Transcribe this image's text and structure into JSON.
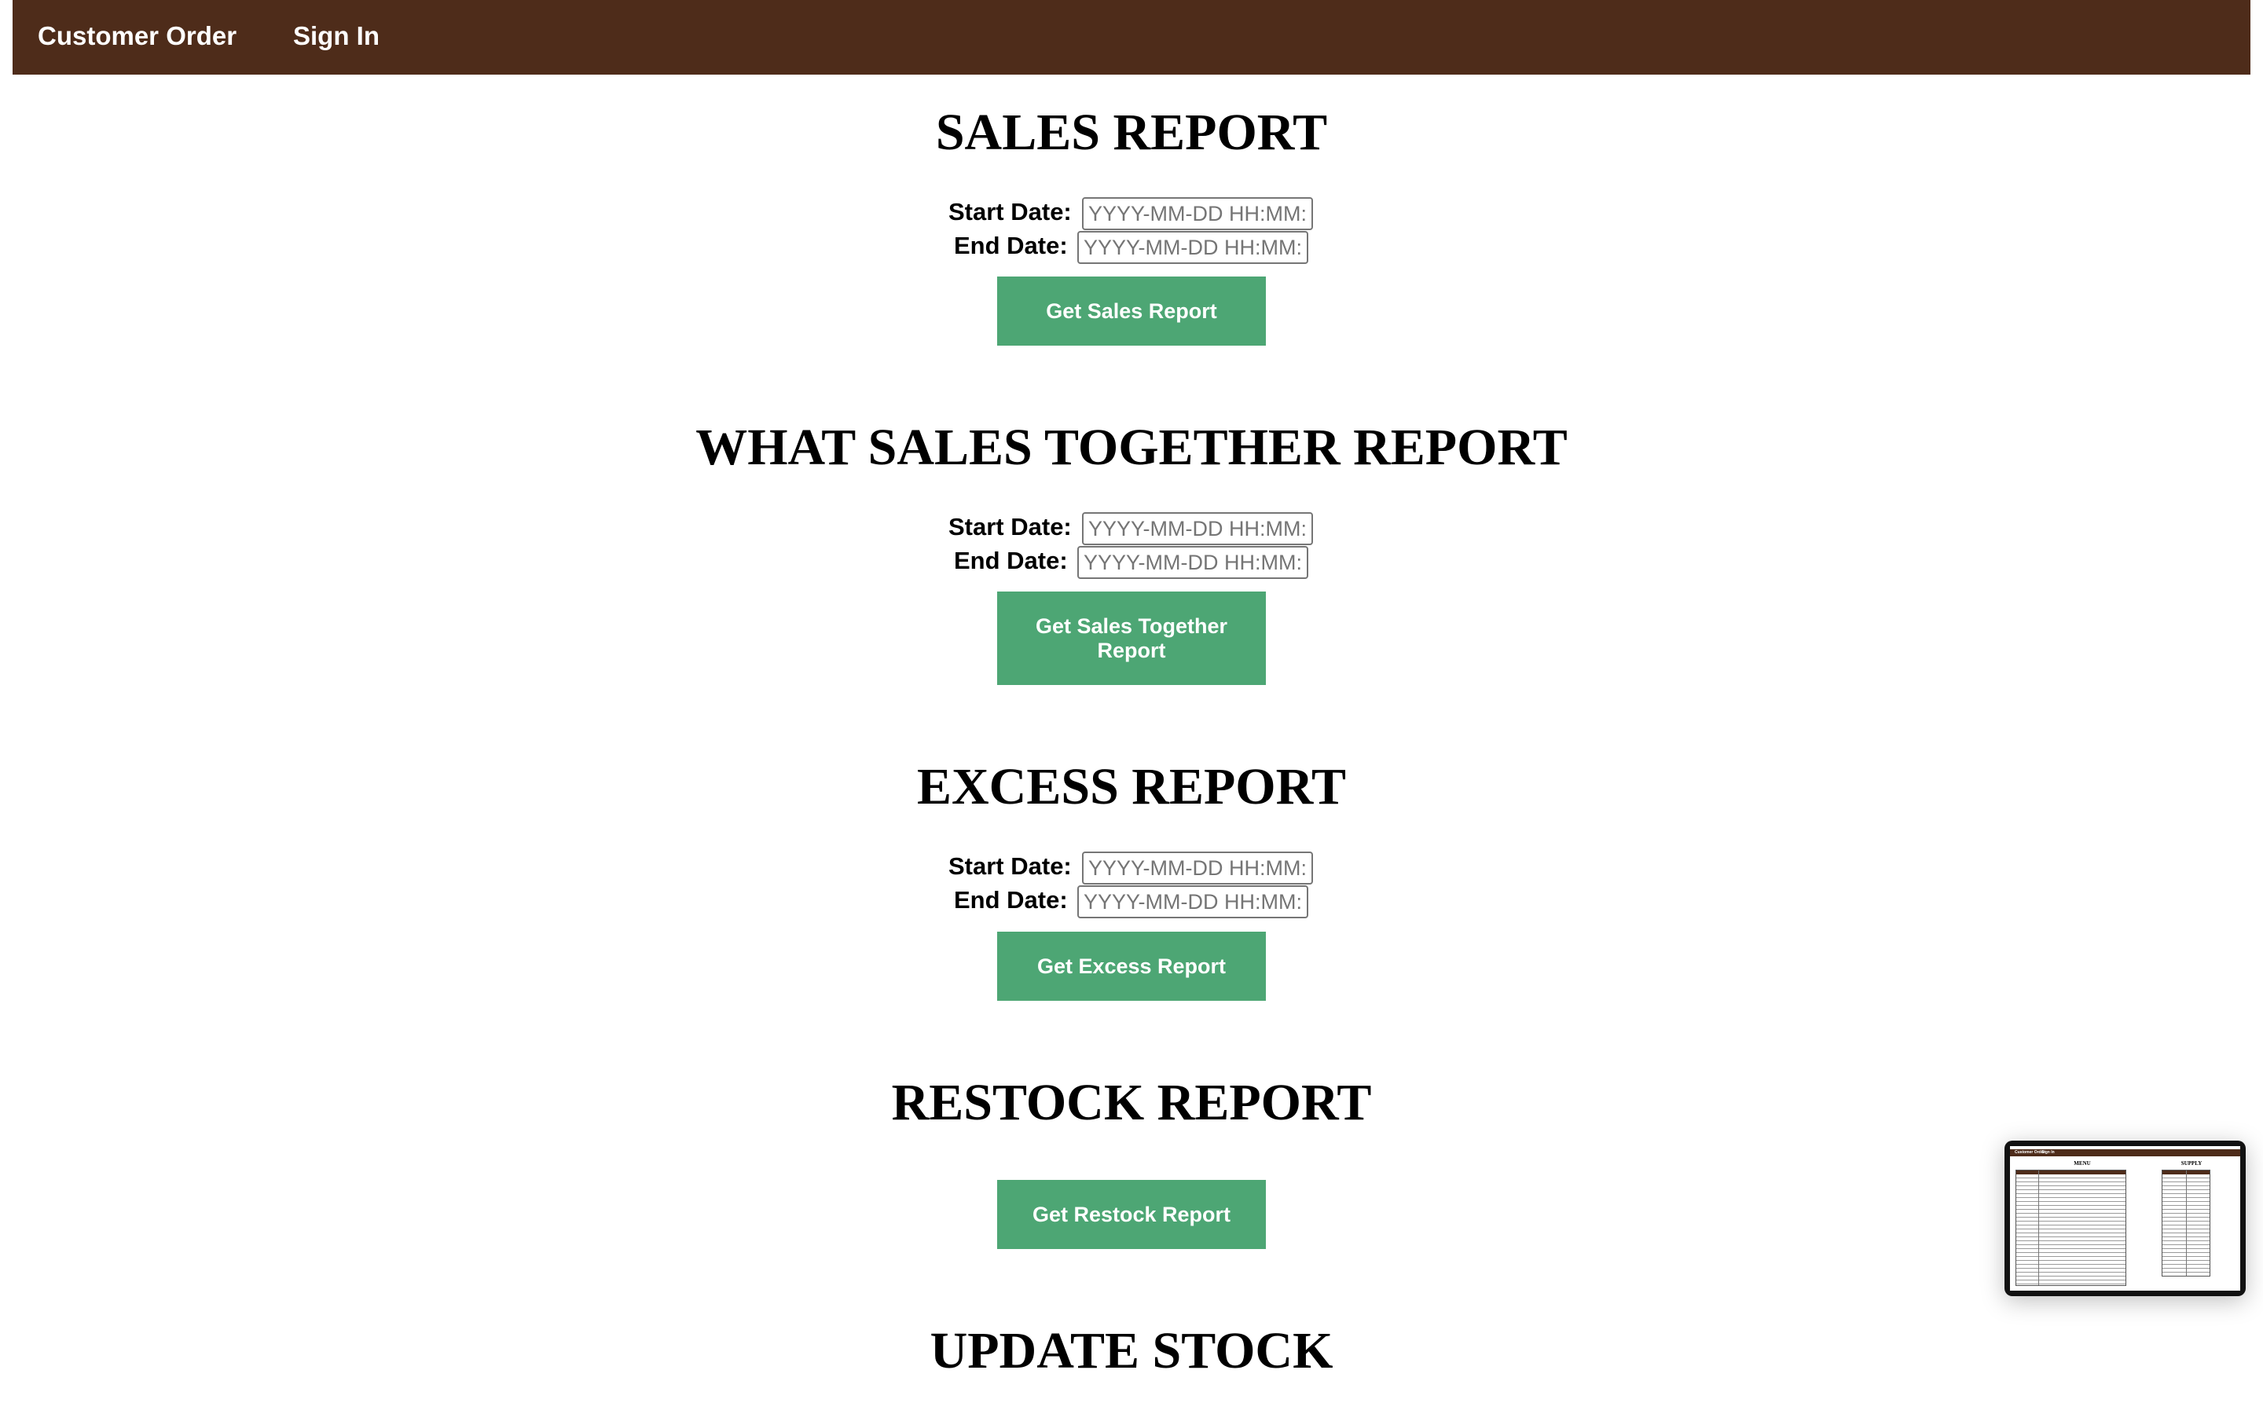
{
  "nav": {
    "customer_order": "Customer Order",
    "sign_in": "Sign In"
  },
  "labels": {
    "start_date": "Start Date:",
    "end_date": "End Date:"
  },
  "date_placeholder": "YYYY-MM-DD HH:MM:SS",
  "sections": {
    "sales": {
      "title": "SALES REPORT",
      "button": "Get Sales Report"
    },
    "sales_together": {
      "title": "WHAT SALES TOGETHER REPORT",
      "button": "Get Sales Together Report"
    },
    "excess": {
      "title": "EXCESS REPORT",
      "button": "Get Excess Report"
    },
    "restock": {
      "title": "RESTOCK REPORT",
      "button": "Get Restock Report"
    },
    "update_stock": {
      "title": "UPDATE STOCK"
    }
  },
  "thumbnail": {
    "nav_customer_order": "Customer Order",
    "nav_sign_in": "Sign In",
    "menu_title": "MENU",
    "supply_title": "SUPPLY"
  },
  "colors": {
    "nav_bg": "#4e2c1a",
    "button_bg": "#4da674"
  }
}
